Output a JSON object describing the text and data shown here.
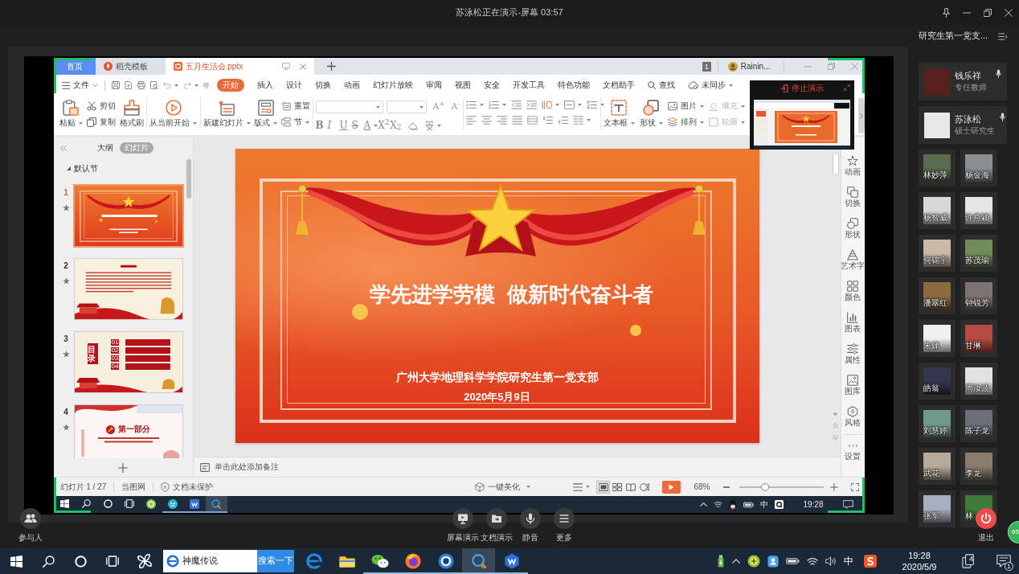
{
  "meeting": {
    "title": "苏泳松正在演示-屏幕 03:57"
  },
  "wps": {
    "tabs": [
      {
        "label": "首页",
        "kind": "home",
        "selected": false
      },
      {
        "label": "稻壳模板",
        "kind": "store",
        "selected": false
      },
      {
        "label": "五月生活会.pptx",
        "kind": "document",
        "selected": true
      }
    ],
    "window_count": "1",
    "user": "Rainin...",
    "file_menu": "文件",
    "menu": [
      {
        "label": "开始",
        "selected": true
      },
      {
        "label": "插入",
        "selected": false
      },
      {
        "label": "设计",
        "selected": false
      },
      {
        "label": "切换",
        "selected": false
      },
      {
        "label": "动画",
        "selected": false
      },
      {
        "label": "幻灯片放映",
        "selected": false
      },
      {
        "label": "审阅",
        "selected": false
      },
      {
        "label": "视图",
        "selected": false
      },
      {
        "label": "安全",
        "selected": false
      },
      {
        "label": "开发工具",
        "selected": false
      },
      {
        "label": "特色功能",
        "selected": false
      },
      {
        "label": "文档助手",
        "selected": false
      }
    ],
    "search": "查找",
    "sync": "未同步",
    "ribbon": {
      "clipboard": [
        {
          "kind": "large",
          "label": "粘贴",
          "dropdown": true
        },
        {
          "kind": "small",
          "label": "剪切"
        },
        {
          "kind": "small",
          "label": "复制"
        },
        {
          "kind": "large",
          "label": "格式刷"
        }
      ],
      "show": [
        {
          "kind": "large",
          "label": "从当前开始",
          "dropdown": true
        }
      ],
      "slides": [
        {
          "kind": "large",
          "label": "新建幻灯片",
          "dropdown": true
        },
        {
          "kind": "large",
          "label": "版式",
          "dropdown": true
        },
        {
          "kind": "small",
          "label": "重置"
        },
        {
          "kind": "small",
          "label": "节",
          "dropdown": true
        }
      ],
      "font": {
        "size_buttons": [
          "A$^{+}$",
          "A$^{-}$"
        ],
        "format_buttons": [
          "B",
          "I",
          "U",
          "S",
          "A",
          "X$^{2}$",
          "X$_{2}$"
        ]
      },
      "insert": [
        {
          "kind": "large",
          "label": "文本框",
          "dropdown": true,
          "disabled": false
        },
        {
          "kind": "large",
          "label": "形状",
          "dropdown": true,
          "disabled": false
        },
        {
          "kind": "small",
          "label": "图片",
          "dropdown": true,
          "disabled": false
        },
        {
          "kind": "small",
          "label": "排列",
          "dropdown": true,
          "disabled": false
        },
        {
          "kind": "small",
          "label": "填充",
          "dropdown": true,
          "disabled": true
        },
        {
          "kind": "small",
          "label": "轮廓",
          "dropdown": true,
          "disabled": true
        }
      ]
    },
    "present_popup": {
      "label": "停止演示"
    },
    "side_tabs": [
      {
        "label": "大纲",
        "selected": false
      },
      {
        "label": "幻灯片",
        "selected": true
      }
    ],
    "section": "默认节",
    "slides": [
      {
        "number": "1",
        "kind": "cover",
        "selected": true
      },
      {
        "number": "2",
        "kind": "preface",
        "selected": false
      },
      {
        "number": "3",
        "kind": "contents",
        "selected": false,
        "title": "目录",
        "entries": [
          "01",
          "02",
          "03",
          "04"
        ]
      },
      {
        "number": "4",
        "kind": "part",
        "selected": false,
        "title": "第一部分"
      }
    ],
    "slide": {
      "title": "学先进学劳模  做新时代奋斗者",
      "subtitle": "广州大学地理科学学院研究生第一党支部",
      "date": "2020年5月9日"
    },
    "notes_placeholder": "单击此处添加备注",
    "side_tools": [
      "动画",
      "切换",
      "形状",
      "艺术字",
      "颜色",
      "图表",
      "属性",
      "图库",
      "风格",
      "设置"
    ],
    "status": {
      "slide_info": "幻灯片 1 / 27",
      "source": "当图网",
      "protection": "文档未保护",
      "beautify": "一键美化",
      "views": [
        {
          "selected": true
        },
        {
          "selected": false
        },
        {
          "selected": false
        },
        {
          "selected": false
        }
      ],
      "zoom": "68%",
      "zoom_slider": {
        "level": 0.31
      }
    },
    "taskbar": {
      "apps": [
        {
          "running": false,
          "selected": false
        },
        {
          "running": true,
          "selected": false
        },
        {
          "running": true,
          "selected": false
        },
        {
          "running": true,
          "selected": true
        }
      ],
      "input_method": "中",
      "time": "19:28"
    }
  },
  "channel": {
    "title": "研究生第一党支..."
  },
  "hosts": [
    {
      "name": "钱乐祥",
      "role": "专任教师"
    },
    {
      "name": "苏泳松",
      "role": "硕士研究生"
    }
  ],
  "attendees": [
    {
      "name": "林妙萍"
    },
    {
      "name": "杨金海"
    },
    {
      "name": "杨智威"
    },
    {
      "name": "许燕颖"
    },
    {
      "name": "何锦宇"
    },
    {
      "name": "苏茂瑜"
    },
    {
      "name": "潘翠红"
    },
    {
      "name": "钟锐芳"
    },
    {
      "name": "朱娣"
    },
    {
      "name": "甘琳"
    },
    {
      "name": "皓翁"
    },
    {
      "name": "周汝波"
    },
    {
      "name": "刘慧婷"
    },
    {
      "name": "陈子龙"
    },
    {
      "name": "武花"
    },
    {
      "name": "李龙"
    },
    {
      "name": "张军"
    },
    {
      "name": "林"
    }
  ],
  "controls": {
    "participants": "参与人",
    "center": [
      "屏幕演示",
      "文档演示",
      "静音",
      "更多"
    ],
    "leave": "退出",
    "network": "65"
  },
  "taskbar": {
    "search_text": "神魔传说",
    "search_button": "搜索一下",
    "apps": [
      {
        "running": false,
        "selected": false
      },
      {
        "running": false,
        "selected": false
      },
      {
        "running": true,
        "selected": false
      },
      {
        "running": true,
        "selected": false
      },
      {
        "running": true,
        "selected": false
      },
      {
        "running": true,
        "selected": true
      },
      {
        "running": true,
        "selected": false
      }
    ],
    "input_method": "中",
    "time": "19:28",
    "date": "2020/5/9",
    "task_count": "4",
    "notifications": "1"
  }
}
